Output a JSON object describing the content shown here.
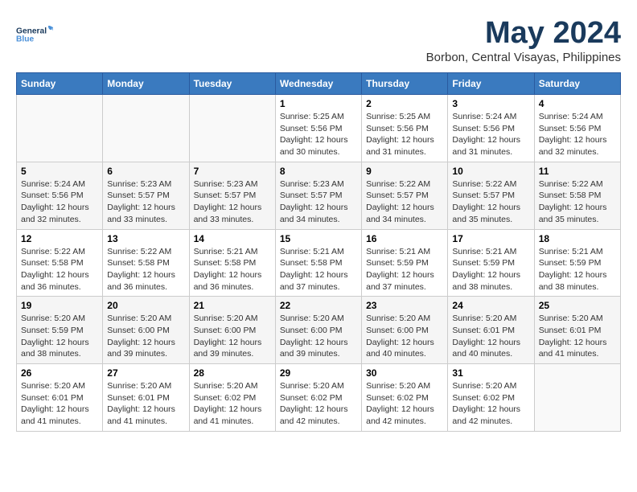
{
  "header": {
    "logo_general": "General",
    "logo_blue": "Blue",
    "month_year": "May 2024",
    "location": "Borbon, Central Visayas, Philippines"
  },
  "weekdays": [
    "Sunday",
    "Monday",
    "Tuesday",
    "Wednesday",
    "Thursday",
    "Friday",
    "Saturday"
  ],
  "weeks": [
    [
      {
        "day": "",
        "sunrise": "",
        "sunset": "",
        "daylight": ""
      },
      {
        "day": "",
        "sunrise": "",
        "sunset": "",
        "daylight": ""
      },
      {
        "day": "",
        "sunrise": "",
        "sunset": "",
        "daylight": ""
      },
      {
        "day": "1",
        "sunrise": "Sunrise: 5:25 AM",
        "sunset": "Sunset: 5:56 PM",
        "daylight": "Daylight: 12 hours and 30 minutes."
      },
      {
        "day": "2",
        "sunrise": "Sunrise: 5:25 AM",
        "sunset": "Sunset: 5:56 PM",
        "daylight": "Daylight: 12 hours and 31 minutes."
      },
      {
        "day": "3",
        "sunrise": "Sunrise: 5:24 AM",
        "sunset": "Sunset: 5:56 PM",
        "daylight": "Daylight: 12 hours and 31 minutes."
      },
      {
        "day": "4",
        "sunrise": "Sunrise: 5:24 AM",
        "sunset": "Sunset: 5:56 PM",
        "daylight": "Daylight: 12 hours and 32 minutes."
      }
    ],
    [
      {
        "day": "5",
        "sunrise": "Sunrise: 5:24 AM",
        "sunset": "Sunset: 5:56 PM",
        "daylight": "Daylight: 12 hours and 32 minutes."
      },
      {
        "day": "6",
        "sunrise": "Sunrise: 5:23 AM",
        "sunset": "Sunset: 5:57 PM",
        "daylight": "Daylight: 12 hours and 33 minutes."
      },
      {
        "day": "7",
        "sunrise": "Sunrise: 5:23 AM",
        "sunset": "Sunset: 5:57 PM",
        "daylight": "Daylight: 12 hours and 33 minutes."
      },
      {
        "day": "8",
        "sunrise": "Sunrise: 5:23 AM",
        "sunset": "Sunset: 5:57 PM",
        "daylight": "Daylight: 12 hours and 34 minutes."
      },
      {
        "day": "9",
        "sunrise": "Sunrise: 5:22 AM",
        "sunset": "Sunset: 5:57 PM",
        "daylight": "Daylight: 12 hours and 34 minutes."
      },
      {
        "day": "10",
        "sunrise": "Sunrise: 5:22 AM",
        "sunset": "Sunset: 5:57 PM",
        "daylight": "Daylight: 12 hours and 35 minutes."
      },
      {
        "day": "11",
        "sunrise": "Sunrise: 5:22 AM",
        "sunset": "Sunset: 5:58 PM",
        "daylight": "Daylight: 12 hours and 35 minutes."
      }
    ],
    [
      {
        "day": "12",
        "sunrise": "Sunrise: 5:22 AM",
        "sunset": "Sunset: 5:58 PM",
        "daylight": "Daylight: 12 hours and 36 minutes."
      },
      {
        "day": "13",
        "sunrise": "Sunrise: 5:22 AM",
        "sunset": "Sunset: 5:58 PM",
        "daylight": "Daylight: 12 hours and 36 minutes."
      },
      {
        "day": "14",
        "sunrise": "Sunrise: 5:21 AM",
        "sunset": "Sunset: 5:58 PM",
        "daylight": "Daylight: 12 hours and 36 minutes."
      },
      {
        "day": "15",
        "sunrise": "Sunrise: 5:21 AM",
        "sunset": "Sunset: 5:58 PM",
        "daylight": "Daylight: 12 hours and 37 minutes."
      },
      {
        "day": "16",
        "sunrise": "Sunrise: 5:21 AM",
        "sunset": "Sunset: 5:59 PM",
        "daylight": "Daylight: 12 hours and 37 minutes."
      },
      {
        "day": "17",
        "sunrise": "Sunrise: 5:21 AM",
        "sunset": "Sunset: 5:59 PM",
        "daylight": "Daylight: 12 hours and 38 minutes."
      },
      {
        "day": "18",
        "sunrise": "Sunrise: 5:21 AM",
        "sunset": "Sunset: 5:59 PM",
        "daylight": "Daylight: 12 hours and 38 minutes."
      }
    ],
    [
      {
        "day": "19",
        "sunrise": "Sunrise: 5:20 AM",
        "sunset": "Sunset: 5:59 PM",
        "daylight": "Daylight: 12 hours and 38 minutes."
      },
      {
        "day": "20",
        "sunrise": "Sunrise: 5:20 AM",
        "sunset": "Sunset: 6:00 PM",
        "daylight": "Daylight: 12 hours and 39 minutes."
      },
      {
        "day": "21",
        "sunrise": "Sunrise: 5:20 AM",
        "sunset": "Sunset: 6:00 PM",
        "daylight": "Daylight: 12 hours and 39 minutes."
      },
      {
        "day": "22",
        "sunrise": "Sunrise: 5:20 AM",
        "sunset": "Sunset: 6:00 PM",
        "daylight": "Daylight: 12 hours and 39 minutes."
      },
      {
        "day": "23",
        "sunrise": "Sunrise: 5:20 AM",
        "sunset": "Sunset: 6:00 PM",
        "daylight": "Daylight: 12 hours and 40 minutes."
      },
      {
        "day": "24",
        "sunrise": "Sunrise: 5:20 AM",
        "sunset": "Sunset: 6:01 PM",
        "daylight": "Daylight: 12 hours and 40 minutes."
      },
      {
        "day": "25",
        "sunrise": "Sunrise: 5:20 AM",
        "sunset": "Sunset: 6:01 PM",
        "daylight": "Daylight: 12 hours and 41 minutes."
      }
    ],
    [
      {
        "day": "26",
        "sunrise": "Sunrise: 5:20 AM",
        "sunset": "Sunset: 6:01 PM",
        "daylight": "Daylight: 12 hours and 41 minutes."
      },
      {
        "day": "27",
        "sunrise": "Sunrise: 5:20 AM",
        "sunset": "Sunset: 6:01 PM",
        "daylight": "Daylight: 12 hours and 41 minutes."
      },
      {
        "day": "28",
        "sunrise": "Sunrise: 5:20 AM",
        "sunset": "Sunset: 6:02 PM",
        "daylight": "Daylight: 12 hours and 41 minutes."
      },
      {
        "day": "29",
        "sunrise": "Sunrise: 5:20 AM",
        "sunset": "Sunset: 6:02 PM",
        "daylight": "Daylight: 12 hours and 42 minutes."
      },
      {
        "day": "30",
        "sunrise": "Sunrise: 5:20 AM",
        "sunset": "Sunset: 6:02 PM",
        "daylight": "Daylight: 12 hours and 42 minutes."
      },
      {
        "day": "31",
        "sunrise": "Sunrise: 5:20 AM",
        "sunset": "Sunset: 6:02 PM",
        "daylight": "Daylight: 12 hours and 42 minutes."
      },
      {
        "day": "",
        "sunrise": "",
        "sunset": "",
        "daylight": ""
      }
    ]
  ]
}
